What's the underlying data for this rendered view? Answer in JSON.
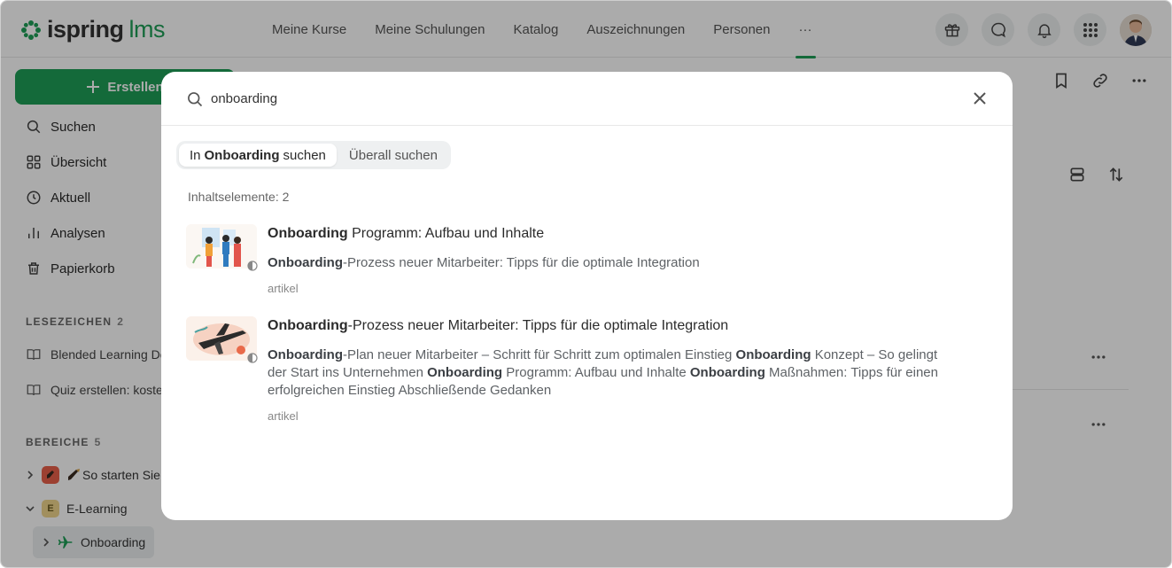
{
  "app": {
    "logo_part1": "ispring",
    "logo_part2": "lms"
  },
  "nav": {
    "items": [
      "Meine Kurse",
      "Meine Schulungen",
      "Katalog",
      "Auszeichnungen",
      "Personen"
    ],
    "more": "···"
  },
  "sidebar": {
    "create_label": "Erstellen",
    "items": [
      "Suchen",
      "Übersicht",
      "Aktuell",
      "Analysen",
      "Papierkorb"
    ],
    "bookmarks_title": "LESEZEICHEN",
    "bookmarks_count": "2",
    "bookmarks": [
      "Blended Learning De",
      "Quiz erstellen: koste"
    ],
    "areas_title": "BEREICHE",
    "areas_count": "5",
    "area1_label": "So starten Sie",
    "area2_badge": "E",
    "area2_label": "E-Learning",
    "area3_label": "Onboarding"
  },
  "search": {
    "query": "onboarding",
    "scope_in_prefix": "In",
    "scope_in_bold": "Onboarding",
    "scope_in_suffix": "suchen",
    "scope_everywhere": "Überall suchen",
    "count_label": "Inhaltselemente: 2"
  },
  "results": [
    {
      "title_bold": "Onboarding",
      "title_rest": " Programm: Aufbau und Inhalte",
      "snippet": [
        {
          "b": "Onboarding"
        },
        {
          "t": "-Prozess neuer Mitarbeiter: Tipps für die optimale Integration"
        }
      ],
      "type": "artikel"
    },
    {
      "title_bold": "Onboarding",
      "title_rest": "-Prozess neuer Mitarbeiter: Tipps für die optimale Integration",
      "snippet": [
        {
          "b": "Onboarding"
        },
        {
          "t": "-Plan neuer Mitarbeiter – Schritt für Schritt zum optimalen Einstieg "
        },
        {
          "b": "Onboarding"
        },
        {
          "t": " Konzept – So gelingt der Start ins Unternehmen "
        },
        {
          "b": "Onboarding"
        },
        {
          "t": " Programm: Aufbau und Inhalte "
        },
        {
          "b": "Onboarding"
        },
        {
          "t": " Maßnahmen: Tipps für einen erfolgreichen Einstieg Abschließende Gedanken"
        }
      ],
      "type": "artikel"
    }
  ],
  "colors": {
    "brand_green": "#1e9e57",
    "overlay": "rgba(0,0,0,0.33)"
  }
}
